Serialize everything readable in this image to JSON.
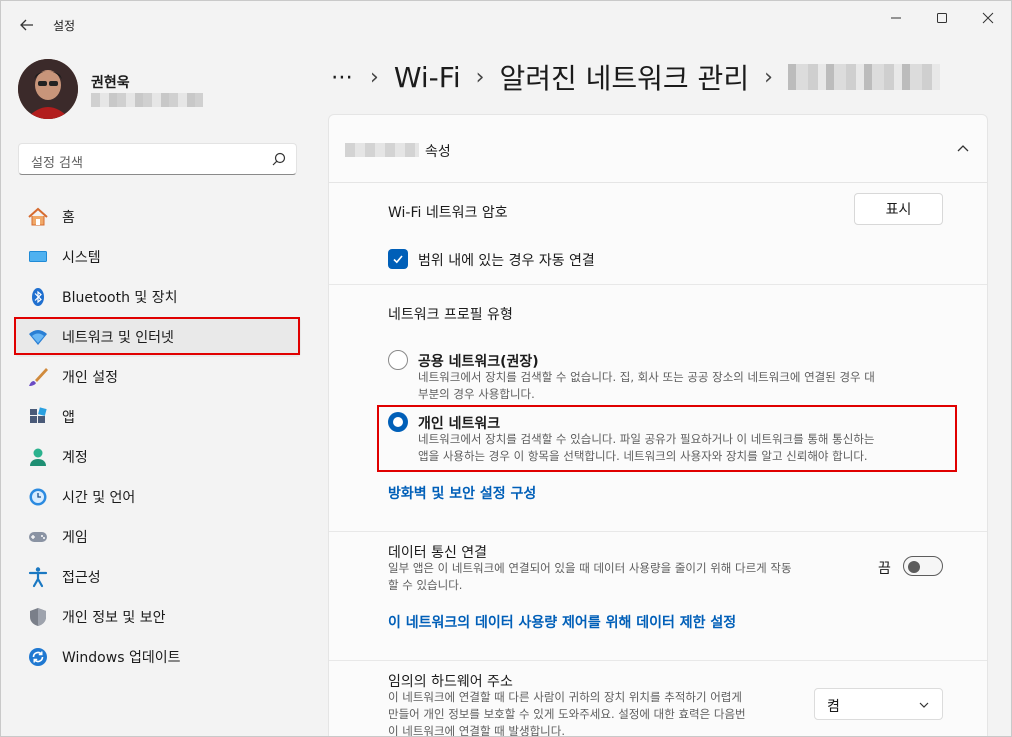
{
  "window": {
    "app_title": "설정"
  },
  "profile": {
    "name": "권현욱"
  },
  "search": {
    "placeholder": "설정 검색"
  },
  "sidebar": {
    "items": [
      {
        "label": "홈",
        "icon": "home-icon"
      },
      {
        "label": "시스템",
        "icon": "system-icon"
      },
      {
        "label": "Bluetooth 및 장치",
        "icon": "bluetooth-icon"
      },
      {
        "label": "네트워크 및 인터넷",
        "icon": "wifi-icon"
      },
      {
        "label": "개인 설정",
        "icon": "brush-icon"
      },
      {
        "label": "앱",
        "icon": "apps-icon"
      },
      {
        "label": "계정",
        "icon": "account-icon"
      },
      {
        "label": "시간 및 언어",
        "icon": "clock-globe-icon"
      },
      {
        "label": "게임",
        "icon": "gamepad-icon"
      },
      {
        "label": "접근성",
        "icon": "accessibility-icon"
      },
      {
        "label": "개인 정보 및 보안",
        "icon": "shield-icon"
      },
      {
        "label": "Windows 업데이트",
        "icon": "update-icon"
      }
    ]
  },
  "breadcrumb": {
    "dots": "⋯",
    "sep": "›",
    "items": [
      "Wi-Fi",
      "알려진 네트워크 관리"
    ]
  },
  "card": {
    "header_suffix": "속성",
    "wifi_password_label": "Wi-Fi 네트워크 암호",
    "show_button": "표시",
    "auto_connect_label": "범위 내에 있는 경우 자동 연결",
    "profile_type_label": "네트워크 프로필 유형",
    "public_title": "공용 네트워크(권장)",
    "public_desc_1": "네트워크에서 장치를 검색할 수 없습니다. 집, 회사 또는 공공 장소의 네트워크에 연결된 경우 대",
    "public_desc_2": "부분의 경우 사용합니다.",
    "private_title": "개인 네트워크",
    "private_desc_1": "네트워크에서 장치를 검색할 수 있습니다. 파일 공유가 필요하거나 이 네트워크를 통해 통신하는",
    "private_desc_2": "앱을 사용하는 경우 이 항목을 선택합니다. 네트워크의 사용자와 장치를 알고 신뢰해야 합니다.",
    "firewall_link": "방화벽 및 보안 설정 구성",
    "metered_label": "데이터 통신 연결",
    "metered_desc_1": "일부 앱은 이 네트워크에 연결되어 있을 때 데이터 사용량을 줄이기 위해 다르게 작동",
    "metered_desc_2": "할 수 있습니다.",
    "metered_state": "끔",
    "data_limit_link": "이 네트워크의 데이터 사용량 제어를 위해 데이터 제한 설정",
    "random_hw_label": "임의의 하드웨어 주소",
    "random_hw_desc_1": "이 네트워크에 연결할 때 다른 사람이 귀하의 장치 위치를 추적하기 어렵게",
    "random_hw_desc_2": "만들어 개인 정보를 보호할 수 있게 도와주세요. 설정에 대한 효력은 다음번",
    "random_hw_desc_3": "이 네트워크에 연결할 때 발생합니다.",
    "random_hw_value": "켬"
  },
  "colors": {
    "accent": "#005fb8",
    "highlight": "#e00000"
  }
}
